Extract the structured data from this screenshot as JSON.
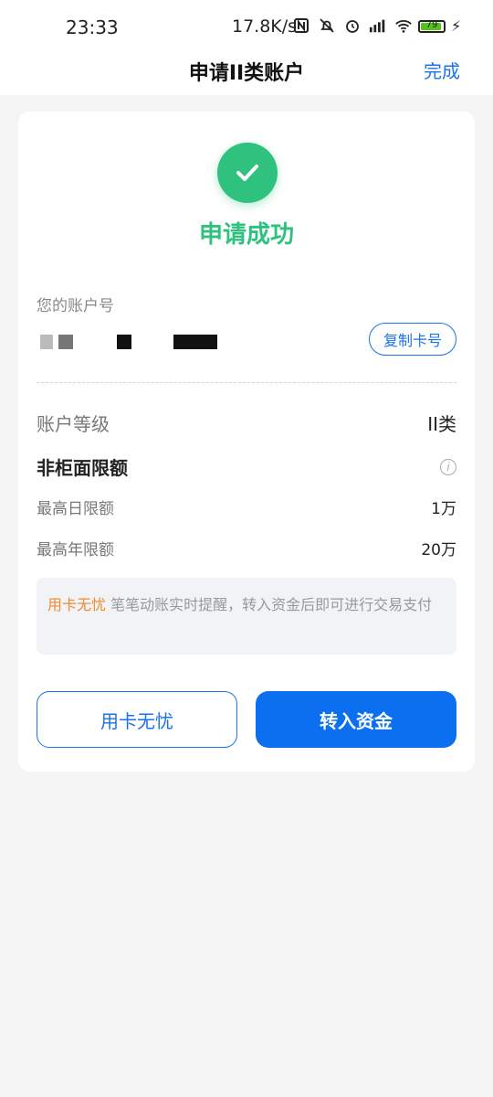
{
  "status_bar": {
    "time": "23:33",
    "network_speed": "17.8K/s",
    "battery": "79",
    "icons": [
      "nfc-icon",
      "bell-off-icon",
      "alarm-icon",
      "signal-icon",
      "wifi-icon",
      "battery-icon",
      "charging-icon"
    ]
  },
  "nav": {
    "title": "申请II类账户",
    "done": "完成"
  },
  "result": {
    "title": "申请成功",
    "accent": "#2ec27e"
  },
  "account": {
    "label": "您的账户号",
    "copy_button": "复制卡号"
  },
  "details": {
    "level_label": "账户等级",
    "level_value": "II类",
    "limits_label": "非柜面限额",
    "daily_label": "最高日限额",
    "daily_value": "1万",
    "yearly_label": "最高年限额",
    "yearly_value": "20万"
  },
  "tip": {
    "highlight": "用卡无忧",
    "text": " 笔笔动账实时提醒，转入资金后即可进行交易支付"
  },
  "buttons": {
    "secondary": "用卡无忧",
    "primary": "转入资金",
    "primary_color": "#0b6ff0"
  }
}
